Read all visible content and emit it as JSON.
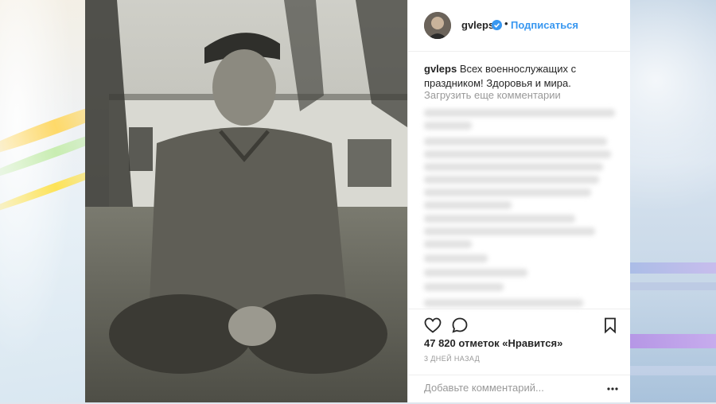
{
  "post": {
    "username": "gvleps",
    "dot": "•",
    "follow_label": "Подписаться",
    "caption_text": "Всех военнослужащих с праздником! Здоровья и мира.",
    "load_more_label": "Загрузить еще комментарии",
    "likes_text": "47 820 отметок «Нравится»",
    "time_ago": "3 ДНЕЙ НАЗАД",
    "comment_placeholder": "Добавьте комментарий..."
  },
  "colors": {
    "link": "#3897f0",
    "verified": "#3897f0",
    "text": "#262626",
    "muted": "#999999"
  },
  "icons": [
    "heart-icon",
    "comment-icon",
    "bookmark-icon",
    "more-options-icon",
    "verified-badge-icon"
  ]
}
